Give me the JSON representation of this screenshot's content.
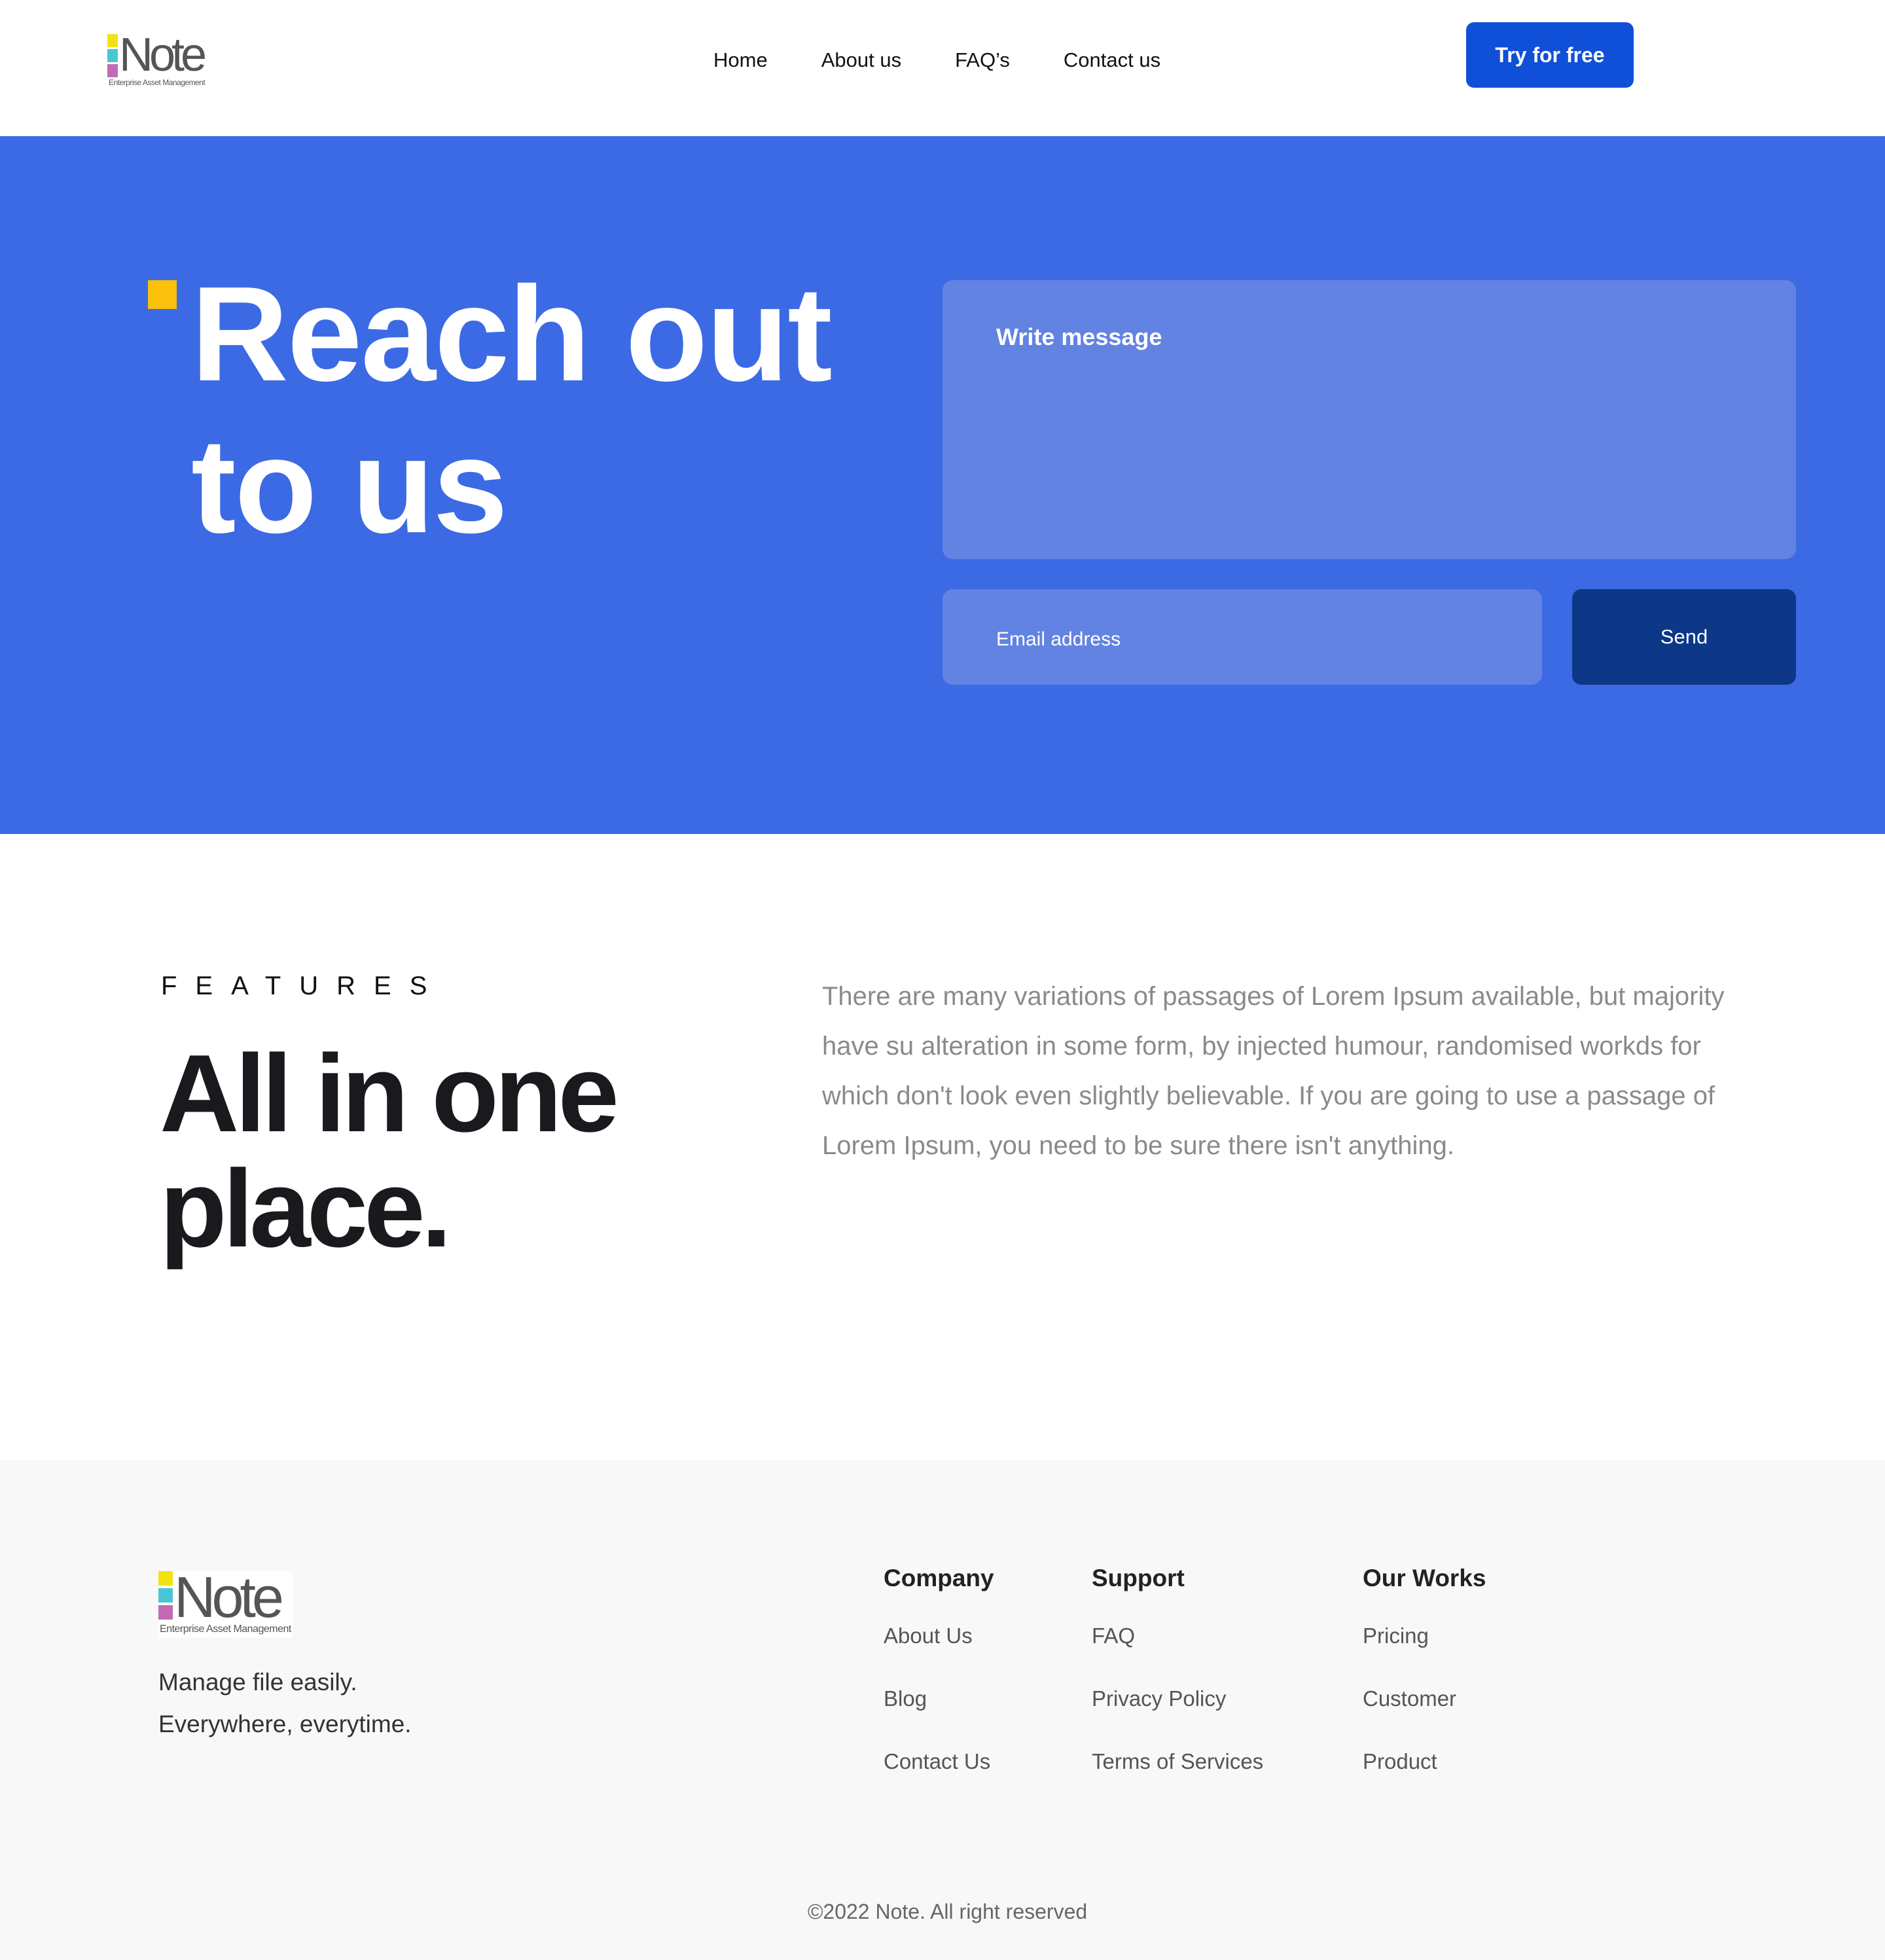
{
  "brand": {
    "logo_word": "Note",
    "logo_tagline": "Enterprise Asset Management",
    "logo_colors": [
      "#f4e114",
      "#48c6d6",
      "#c36ab5"
    ]
  },
  "nav": {
    "items": [
      "Home",
      "About us",
      "FAQ’s",
      "Contact us"
    ],
    "cta_label": "Try for free"
  },
  "hero": {
    "title_line1": "Reach out",
    "title_line2": "to us",
    "message_placeholder": "Write message",
    "email_placeholder": "Email address",
    "send_label": "Send",
    "accent_color": "#f9c00c",
    "background_color": "#3c6ae4"
  },
  "features": {
    "label": "FEATURES",
    "title_line1": "All in one",
    "title_line2": "place.",
    "description": "There are many variations of passages of Lorem Ipsum available, but majority have su alteration in some form, by injected humour, randomised workds for which don't look even slightly believable. If you are going to use a passage of Lorem Ipsum, you need to be sure there isn't anything."
  },
  "footer": {
    "tagline_line1": "Manage file easily.",
    "tagline_line2": "Everywhere, everytime.",
    "columns": [
      {
        "heading": "Company",
        "links": [
          "About Us",
          "Blog",
          "Contact Us"
        ]
      },
      {
        "heading": "Support",
        "links": [
          "FAQ",
          "Privacy Policy",
          "Terms of Services"
        ]
      },
      {
        "heading": "Our Works",
        "links": [
          "Pricing",
          "Customer",
          "Product"
        ]
      }
    ],
    "copyright": "©2022 Note. All right reserved"
  }
}
